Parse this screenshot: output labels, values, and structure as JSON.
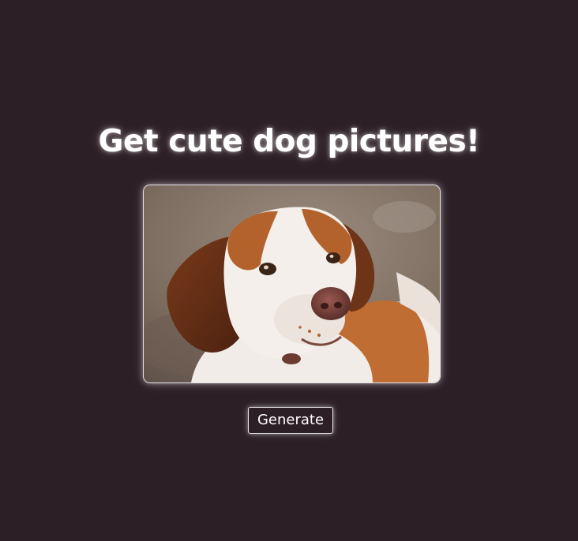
{
  "app": {
    "title": "Get cute dog pictures!"
  },
  "image": {
    "icon": "dog-photo"
  },
  "controls": {
    "generate_label": "Generate"
  },
  "colors": {
    "background": "#2c1f26",
    "text": "#ffffff",
    "glow": "#ffffff"
  }
}
